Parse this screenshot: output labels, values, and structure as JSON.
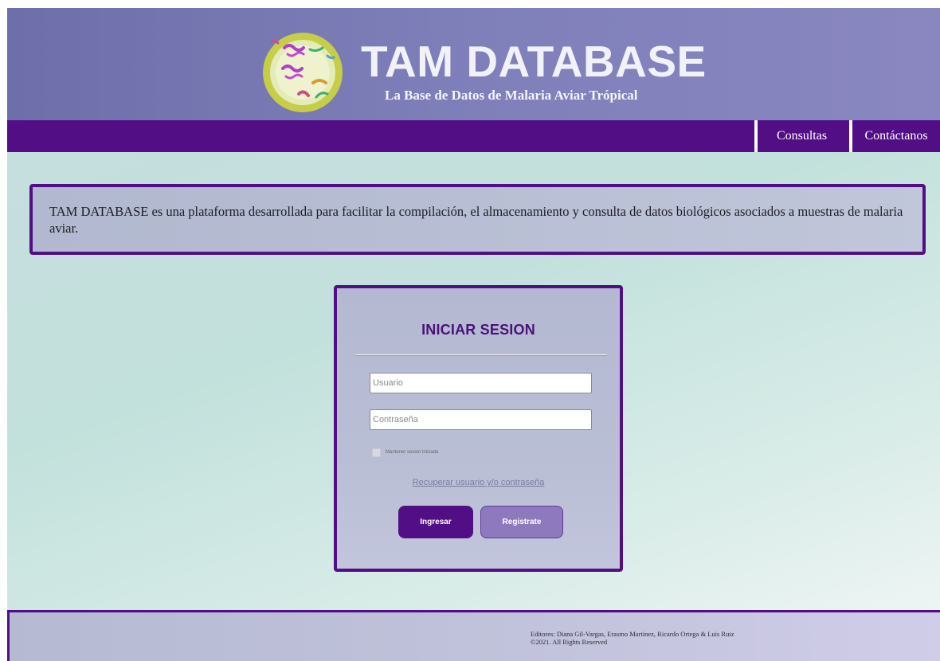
{
  "header": {
    "title": "TAM DATABASE",
    "subtitle": "La Base de Datos de Malaria Aviar Trópical"
  },
  "nav": {
    "items": [
      {
        "label": "Consultas"
      },
      {
        "label": "Contáctanos"
      }
    ]
  },
  "intro": {
    "text": "TAM DATABASE es una plataforma desarrollada para facilitar la compilación, el almacenamiento y consulta de datos biológicos asociados a muestras de malaria aviar."
  },
  "login": {
    "title": "INICIAR SESION",
    "username_placeholder": "Usuario",
    "password_placeholder": "Contraseña",
    "remember_label": "Mantener sesion iniciada",
    "recover_link": "Recuperar usuario y/o contraseña",
    "login_button": "Ingresar",
    "register_button": "Registrate"
  },
  "footer": {
    "editors": "Editores: Diana Gil-Vargas, Erasmo Martinez, Ricardo Ortega & Luis Ruiz",
    "copyright": "©2021. All Rights Reserved"
  },
  "colors": {
    "primary_purple": "#520e85",
    "header_bg": "#7f7fba",
    "secondary_button": "#8e79bf",
    "logo_ring": "#c5cc4a"
  },
  "icons": {
    "logo": "malaria-parasite-cell-logo"
  }
}
